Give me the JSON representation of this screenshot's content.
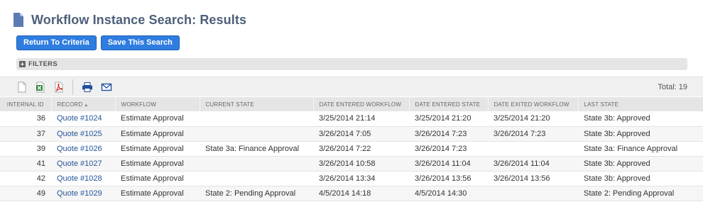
{
  "page": {
    "title": "Workflow Instance Search: Results",
    "icon": "document-icon"
  },
  "buttons": {
    "return_label": "Return To Criteria",
    "save_label": "Save This Search"
  },
  "filters": {
    "label": "FILTERS"
  },
  "toolbar": {
    "icons": [
      "document-export-icon",
      "excel-export-icon",
      "pdf-export-icon",
      "print-icon",
      "email-icon"
    ],
    "total": "Total: 19"
  },
  "colors": {
    "button": "#2f7de0",
    "title": "#4d5f79",
    "link": "#255599"
  },
  "table": {
    "columns": [
      "INTERNAL ID",
      "RECORD",
      "WORKFLOW",
      "CURRENT STATE",
      "DATE ENTERED WORKFLOW",
      "DATE ENTERED STATE",
      "DATE EXITED WORKFLOW",
      "LAST STATE"
    ],
    "sort_indicator": "▲",
    "rows": [
      [
        "36",
        "Quote #1024",
        "Estimate Approval",
        "",
        "3/25/2014 21:14",
        "3/25/2014 21:20",
        "3/25/2014 21:20",
        "State 3b: Approved"
      ],
      [
        "37",
        "Quote #1025",
        "Estimate Approval",
        "",
        "3/26/2014 7:05",
        "3/26/2014 7:23",
        "3/26/2014 7:23",
        "State 3b: Approved"
      ],
      [
        "39",
        "Quote #1026",
        "Estimate Approval",
        "State 3a: Finance Approval",
        "3/26/2014 7:22",
        "3/26/2014 7:23",
        "",
        "State 3a: Finance Approval"
      ],
      [
        "41",
        "Quote #1027",
        "Estimate Approval",
        "",
        "3/26/2014 10:58",
        "3/26/2014 11:04",
        "3/26/2014 11:04",
        "State 3b: Approved"
      ],
      [
        "42",
        "Quote #1028",
        "Estimate Approval",
        "",
        "3/26/2014 13:34",
        "3/26/2014 13:56",
        "3/26/2014 13:56",
        "State 3b: Approved"
      ],
      [
        "49",
        "Quote #1029",
        "Estimate Approval",
        "State 2: Pending Approval",
        "4/5/2014 14:18",
        "4/5/2014 14:30",
        "",
        "State 2: Pending Approval"
      ]
    ]
  }
}
